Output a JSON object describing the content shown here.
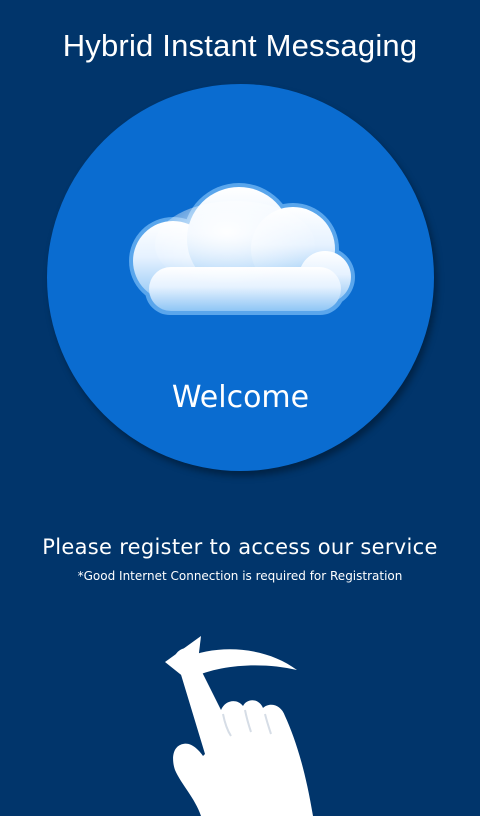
{
  "header": {
    "title": "Hybrid Instant Messaging"
  },
  "hero": {
    "welcome_text": "Welcome",
    "icon": "cloud-icon"
  },
  "message": {
    "primary": "Please register to access our service",
    "note": "*Good Internet Connection is required for Registration"
  },
  "gesture": {
    "icon": "swipe-left-hand-icon"
  },
  "colors": {
    "background": "#01356b",
    "circle": "#0a6cd0",
    "text": "#ffffff"
  }
}
